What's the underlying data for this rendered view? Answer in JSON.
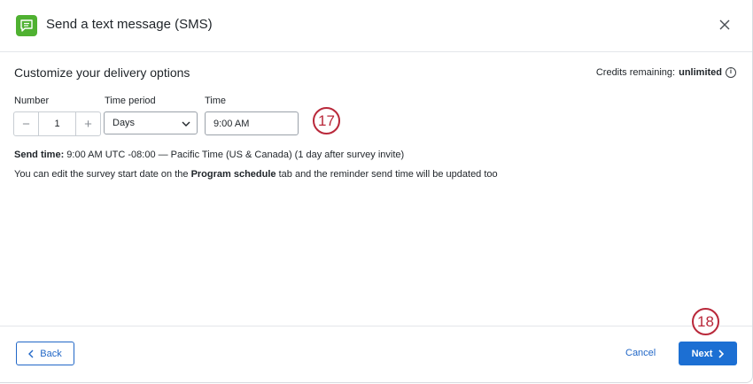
{
  "header": {
    "title": "Send a text message (SMS)"
  },
  "delivery": {
    "section_title": "Customize your delivery options",
    "credits_label": "Credits remaining:",
    "credits_value": "unlimited"
  },
  "form": {
    "number_label": "Number",
    "number_value": "1",
    "minus": "−",
    "plus": "+",
    "period_label": "Time period",
    "period_value": "Days",
    "time_label": "Time",
    "time_value": "9:00 AM"
  },
  "annotations": {
    "step_17": "17",
    "step_18": "18"
  },
  "info": {
    "send_time_label": "Send time:",
    "send_time_value": " 9:00 AM UTC -08:00 — Pacific Time (US & Canada) (1 day after survey invite)",
    "note_before": "You can edit the survey start date on the ",
    "note_bold": "Program schedule",
    "note_after": " tab and the reminder send time will be updated too"
  },
  "footer": {
    "back": "Back",
    "cancel": "Cancel",
    "next": "Next"
  },
  "colors": {
    "brand_green": "#4fb131",
    "primary_blue": "#1c6fd3",
    "annotation_red": "#b9283a"
  },
  "icons": {
    "header": "sms-chat-icon",
    "close": "close-icon",
    "info": "info-icon",
    "dropdown": "chevron-down-icon",
    "back": "chevron-left-icon",
    "next": "chevron-right-icon"
  }
}
